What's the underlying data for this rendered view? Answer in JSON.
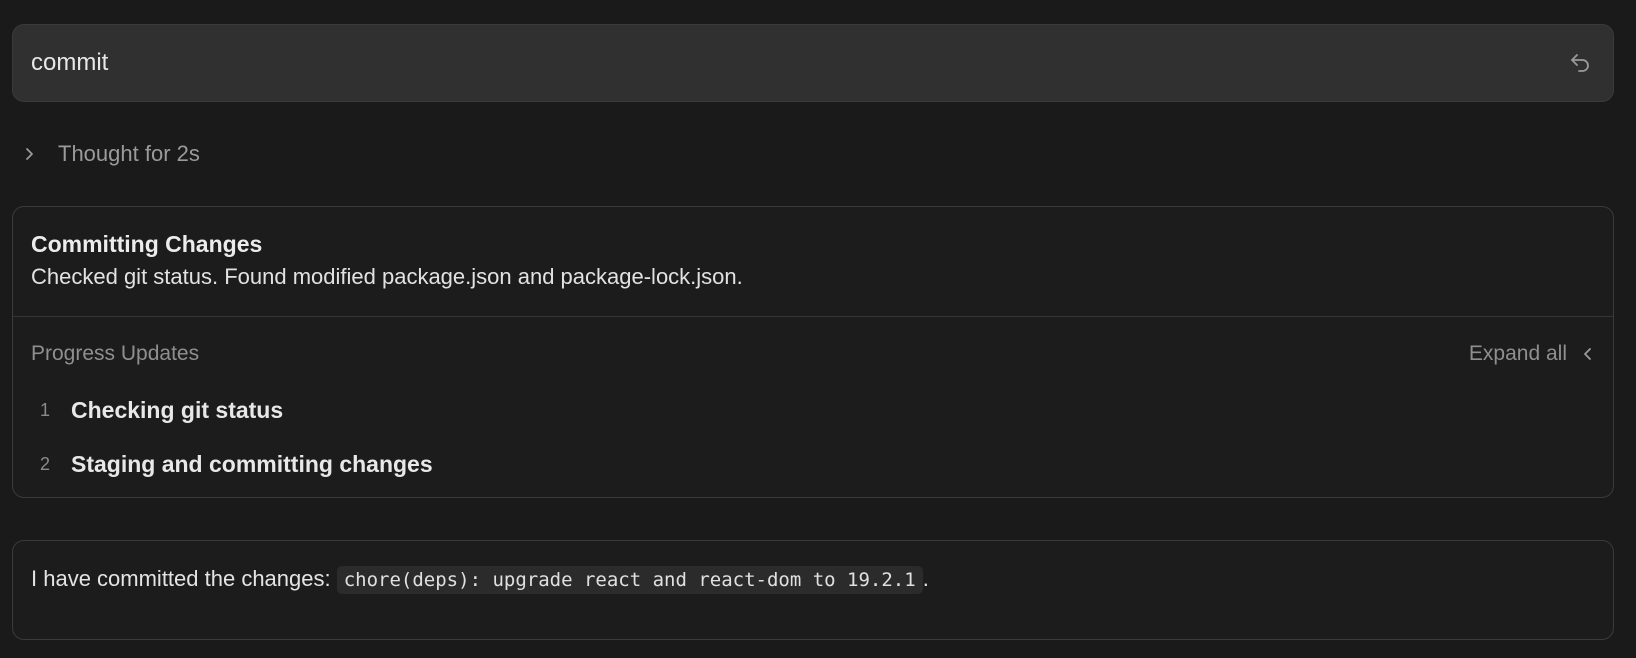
{
  "prompt": {
    "text": "commit",
    "undo_icon": "undo-icon"
  },
  "thought": {
    "label": "Thought for 2s",
    "icon": "chevron-right-icon"
  },
  "task_card": {
    "title": "Committing Changes",
    "summary": "Checked git status. Found modified package.json and package-lock.json.",
    "progress": {
      "title": "Progress Updates",
      "expand_label": "Expand all",
      "expand_icon": "chevron-left-icon",
      "items": [
        {
          "number": "1",
          "label": "Checking git status"
        },
        {
          "number": "2",
          "label": "Staging and committing changes"
        }
      ]
    }
  },
  "response": {
    "prefix": "I have committed the changes: ",
    "code": "chore(deps): upgrade react and react-dom to 19.2.1",
    "suffix": "."
  },
  "colors": {
    "background": "#1a1a1a",
    "prompt_bubble": "#303030",
    "border": "#3b3b3b",
    "muted_text": "#8f8f8f"
  }
}
